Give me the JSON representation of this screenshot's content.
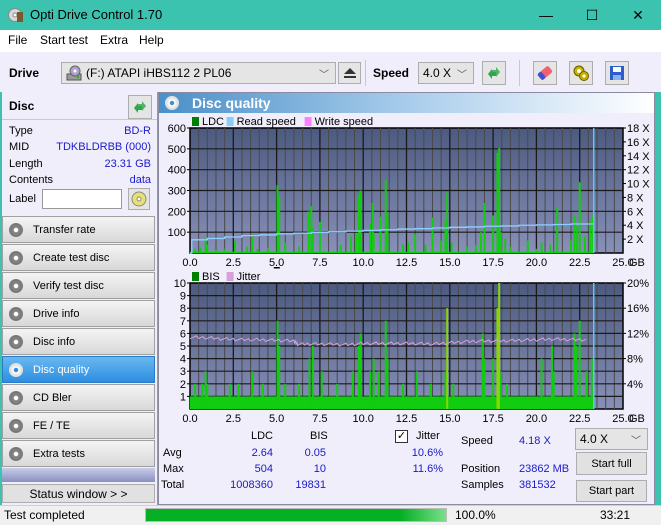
{
  "window": {
    "title": "Opti Drive Control 1.70",
    "minimize": "—",
    "maximize": "☐",
    "close": "✕"
  },
  "menu": [
    "File",
    "Start test",
    "Extra",
    "Help"
  ],
  "toolbar": {
    "drive_label": "Drive",
    "drive_value": "(F:)  ATAPI iHBS112  2 PL06",
    "speed_label": "Speed",
    "speed_value": "4.0 X"
  },
  "disc": {
    "header": "Disc",
    "fields": [
      {
        "label": "Type",
        "value": "BD-R"
      },
      {
        "label": "MID",
        "value": "TDKBLDRBB (000)"
      },
      {
        "label": "Length",
        "value": "23.31 GB"
      },
      {
        "label": "Contents",
        "value": "data"
      }
    ],
    "label_field": {
      "label": "Label",
      "value": ""
    }
  },
  "nav": [
    {
      "label": "Transfer rate",
      "active": false
    },
    {
      "label": "Create test disc",
      "active": false
    },
    {
      "label": "Verify test disc",
      "active": false
    },
    {
      "label": "Drive info",
      "active": false
    },
    {
      "label": "Disc info",
      "active": false
    },
    {
      "label": "Disc quality",
      "active": true
    },
    {
      "label": "CD Bler",
      "active": false
    },
    {
      "label": "FE / TE",
      "active": false
    },
    {
      "label": "Extra tests",
      "active": false
    }
  ],
  "status_window_button": "Status window > >",
  "panel_title": "Disc quality",
  "chart_data": [
    {
      "type": "bar",
      "title": "LDC / Read speed",
      "legend": [
        "LDC",
        "Read speed",
        "Write speed"
      ],
      "legend_colors": [
        "#008000",
        "#87cefa",
        "#ff80ff"
      ],
      "xlabel": "GB",
      "x_ticks": [
        "0.0",
        "2.5",
        "5.0",
        "7.5",
        "10.0",
        "12.5",
        "15.0",
        "17.5",
        "20.0",
        "22.5",
        "25.0"
      ],
      "xlim": [
        0,
        25
      ],
      "y_ticks": [
        "100",
        "200",
        "300",
        "400",
        "500",
        "600"
      ],
      "ylim": [
        0,
        600
      ],
      "y2_ticks": [
        "2 X",
        "4 X",
        "6 X",
        "8 X",
        "10 X",
        "12 X",
        "14 X",
        "16 X",
        "18 X"
      ],
      "y2lim": [
        0,
        18
      ],
      "end_marker_gb": 23.31,
      "series": [
        {
          "name": "LDC",
          "x": [
            0.3,
            0.6,
            0.9,
            1.0,
            1.5,
            2.0,
            2.6,
            3.3,
            3.6,
            3.9,
            4.5,
            5.05,
            5.15,
            5.5,
            6.3,
            6.85,
            7.0,
            7.1,
            7.5,
            8.7,
            9.3,
            9.6,
            9.75,
            9.85,
            10.4,
            10.55,
            10.6,
            11.0,
            11.3,
            11.4,
            12.3,
            12.6,
            13.0,
            13.6,
            14.0,
            14.5,
            14.75,
            14.85,
            15.1,
            16.0,
            16.5,
            16.8,
            17.0,
            17.5,
            17.75,
            17.85,
            17.95,
            18.2,
            18.5,
            19.5,
            20.0,
            20.3,
            20.8,
            21.2,
            22.0,
            22.2,
            22.35,
            22.5,
            22.8,
            23.1,
            23.25
          ],
          "values": [
            20,
            25,
            70,
            40,
            15,
            20,
            60,
            30,
            80,
            20,
            25,
            325,
            270,
            50,
            30,
            200,
            225,
            120,
            150,
            40,
            80,
            90,
            280,
            300,
            140,
            240,
            90,
            175,
            350,
            190,
            40,
            50,
            90,
            40,
            170,
            60,
            150,
            290,
            50,
            30,
            40,
            100,
            240,
            180,
            480,
            504,
            100,
            70,
            30,
            60,
            20,
            50,
            40,
            220,
            60,
            180,
            130,
            340,
            80,
            150,
            180
          ]
        },
        {
          "name": "Read speed",
          "unit": "X",
          "x": [
            0.0,
            0.1,
            1.0,
            2.0,
            3.0,
            4.0,
            5.0,
            6.0,
            7.0,
            8.0,
            9.0,
            10.0,
            11.0,
            12.0,
            13.0,
            14.0,
            15.0,
            16.0,
            17.0,
            18.0,
            19.0,
            20.0,
            21.0,
            22.0,
            23.31
          ],
          "values": [
            0,
            1.9,
            2.1,
            2.3,
            2.5,
            2.6,
            2.75,
            2.85,
            2.95,
            3.05,
            3.15,
            3.25,
            3.35,
            3.45,
            3.5,
            3.6,
            3.7,
            3.75,
            3.85,
            3.9,
            4.0,
            4.05,
            4.1,
            4.18,
            4.2
          ]
        }
      ]
    },
    {
      "type": "bar",
      "title": "BIS / Jitter",
      "legend": [
        "BIS",
        "Jitter"
      ],
      "legend_colors": [
        "#008000",
        "#d8a0d8"
      ],
      "xlabel": "GB",
      "x_ticks": [
        "0.0",
        "2.5",
        "5.0",
        "7.5",
        "10.0",
        "12.5",
        "15.0",
        "17.5",
        "20.0",
        "22.5",
        "25.0"
      ],
      "xlim": [
        0,
        25
      ],
      "y_ticks": [
        "1",
        "2",
        "3",
        "4",
        "5",
        "6",
        "7",
        "8",
        "9",
        "10"
      ],
      "ylim": [
        0,
        10
      ],
      "y2_ticks": [
        "4%",
        "8%",
        "12%",
        "16%",
        "20%"
      ],
      "y2lim": [
        0,
        20
      ],
      "end_marker_gb": 23.31,
      "series": [
        {
          "name": "BIS",
          "baseline": 1,
          "x": [
            0.3,
            0.7,
            0.9,
            1.0,
            2.3,
            2.8,
            3.6,
            4.2,
            5.05,
            5.15,
            5.5,
            6.3,
            6.9,
            7.1,
            7.6,
            8.5,
            9.4,
            9.75,
            9.85,
            10.4,
            10.6,
            10.9,
            11.3,
            11.4,
            12.3,
            13.1,
            13.9,
            14.75,
            14.85,
            15.2,
            16.9,
            17.0,
            17.5,
            17.75,
            17.85,
            17.95,
            18.3,
            20.3,
            20.9,
            21.0,
            22.2,
            22.3,
            22.5,
            22.9,
            23.2
          ],
          "values": [
            2,
            2,
            3,
            2,
            2,
            2,
            3,
            2,
            7,
            5,
            2,
            2,
            4,
            5,
            3,
            2,
            3,
            5,
            6,
            3,
            4,
            3,
            7,
            4,
            2,
            3,
            2,
            3,
            8,
            2,
            6,
            4,
            4,
            8,
            10,
            3,
            2,
            4,
            5,
            3,
            6,
            5,
            7,
            3,
            4
          ]
        },
        {
          "name": "Jitter",
          "unit": "%",
          "x": [
            0.0,
            1.0,
            2.0,
            3.0,
            4.0,
            5.0,
            6.0,
            6.2,
            7.0,
            8.0,
            9.0,
            10.0,
            11.0,
            12.0,
            13.0,
            14.0,
            15.0,
            16.0,
            17.0,
            18.0,
            19.0,
            20.0,
            21.0,
            22.0,
            23.0
          ],
          "values": [
            11.4,
            11.3,
            11.1,
            11.0,
            11.0,
            10.9,
            10.8,
            10.3,
            10.3,
            10.3,
            10.2,
            10.4,
            10.4,
            10.4,
            10.4,
            10.3,
            10.5,
            10.7,
            10.8,
            10.8,
            10.9,
            11.0,
            11.1,
            11.0,
            11.0
          ]
        }
      ]
    }
  ],
  "stats": {
    "col_headers": [
      "LDC",
      "BIS"
    ],
    "rows": [
      {
        "label": "Avg",
        "ldc": "2.64",
        "bis": "0.05",
        "jitter": "10.6%"
      },
      {
        "label": "Max",
        "ldc": "504",
        "bis": "10",
        "jitter": "11.6%"
      },
      {
        "label": "Total",
        "ldc": "1008360",
        "bis": "19831",
        "jitter": ""
      }
    ],
    "jitter_label": "Jitter",
    "jitter_checked": true,
    "speed_label": "Speed",
    "speed_value": "4.18 X",
    "position_label": "Position",
    "position_value": "23862 MB",
    "samples_label": "Samples",
    "samples_value": "381532",
    "speed_select": "4.0 X",
    "start_full": "Start full",
    "start_part": "Start part"
  },
  "statusbar": {
    "text": "Test completed",
    "progress_percent": 100,
    "progress_text": "100.0%",
    "elapsed": "33:21"
  }
}
